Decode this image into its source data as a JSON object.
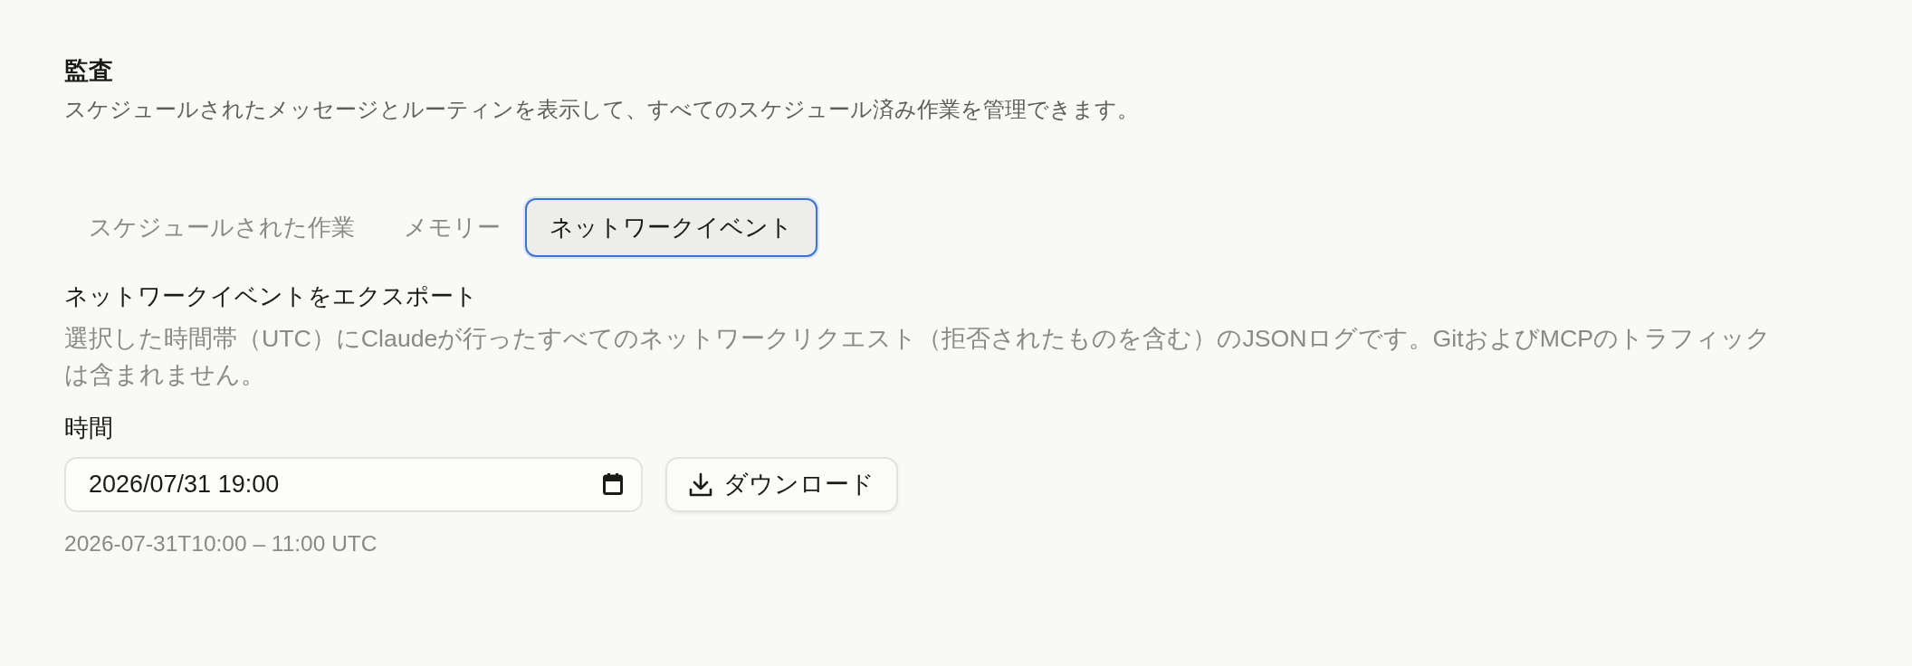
{
  "page": {
    "title": "監査",
    "subtitle": "スケジュールされたメッセージとルーティンを表示して、すべてのスケジュール済み作業を管理できます。"
  },
  "tabs": [
    {
      "label": "スケジュールされた作業",
      "selected": false
    },
    {
      "label": "メモリー",
      "selected": false
    },
    {
      "label": "ネットワークイベント",
      "selected": true
    }
  ],
  "export_section": {
    "heading": "ネットワークイベントをエクスポート",
    "description": "選択した時間帯（UTC）にClaudeが行ったすべてのネットワークリクエスト（拒否されたものを含む）のJSONログです。GitおよびMCPのトラフィックは含まれません。",
    "time_field": {
      "label": "時間",
      "value": "2026/07/31 19:00"
    },
    "download_button": {
      "label": "ダウンロード"
    },
    "range_hint": "2026-07-31T10:00 – 11:00 UTC"
  }
}
